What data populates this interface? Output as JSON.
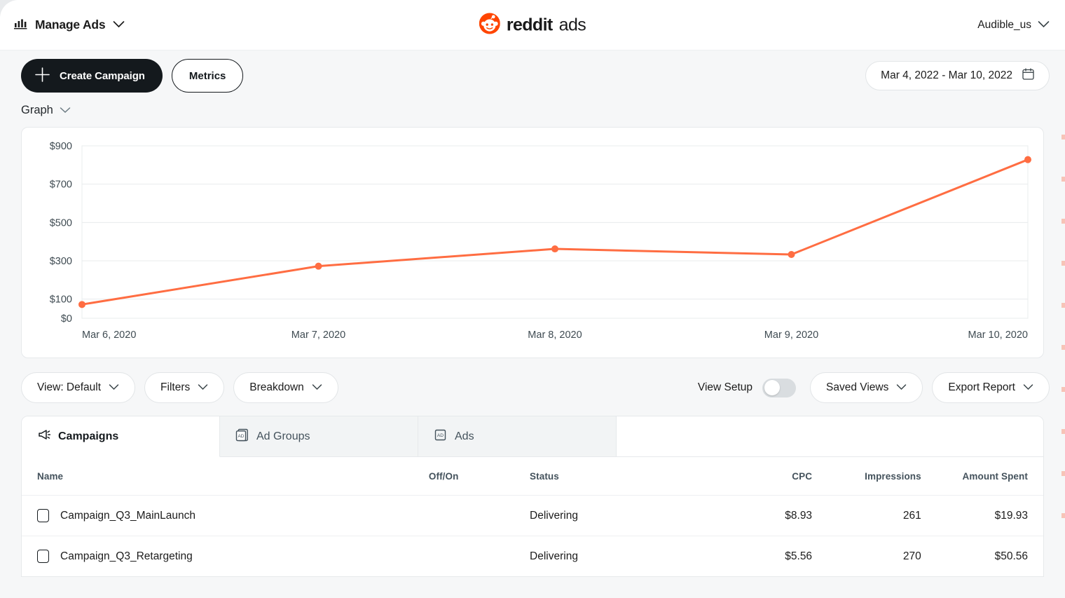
{
  "topbar": {
    "menu_label": "Manage Ads",
    "menu_icon": "bar-chart-icon",
    "brand_word": "reddit",
    "brand_ads": "ads",
    "brand_icon": "reddit-snoo-icon",
    "account_label": "Audible_us",
    "chevron_icon": "chevron-down-icon"
  },
  "actions": {
    "create_campaign_label": "Create Campaign",
    "create_icon": "plus-icon",
    "metrics_label": "Metrics",
    "date_range_label": "Mar 4, 2022 - Mar 10, 2022",
    "calendar_icon": "calendar-icon"
  },
  "graph_section": {
    "label": "Graph"
  },
  "chart_data": {
    "type": "line",
    "title": "",
    "xlabel": "",
    "ylabel": "",
    "categories": [
      "Mar 6, 2020",
      "Mar 7, 2020",
      "Mar 8, 2020",
      "Mar 9, 2020",
      "Mar 10, 2020"
    ],
    "series": [
      {
        "name": "Amount Spent",
        "values": [
          72,
          272,
          362,
          333,
          828
        ],
        "color": "#ff6d42"
      }
    ],
    "ytick_labels": [
      "$0",
      "$100",
      "$300",
      "$500",
      "$700",
      "$900"
    ],
    "ytick_values": [
      0,
      100,
      300,
      500,
      700,
      900
    ],
    "ylim": [
      0,
      900
    ],
    "grid": true,
    "legend": "none",
    "point_radius": 5,
    "line_width": 3
  },
  "controls": {
    "view_label": "View: Default",
    "filters_label": "Filters",
    "breakdown_label": "Breakdown",
    "view_setup_label": "View Setup",
    "view_setup_on": false,
    "saved_views_label": "Saved Views",
    "export_report_label": "Export Report"
  },
  "tabs": [
    {
      "label": "Campaigns",
      "icon": "megaphone-icon",
      "active": true
    },
    {
      "label": "Ad Groups",
      "icon": "ad-box-icon",
      "active": false
    },
    {
      "label": "Ads",
      "icon": "ad-box-icon",
      "active": false
    }
  ],
  "table": {
    "headers": {
      "name": "Name",
      "offon": "Off/On",
      "status": "Status",
      "cpc": "CPC",
      "impressions": "Impressions",
      "amount_spent": "Amount Spent"
    },
    "rows": [
      {
        "name": "Campaign_Q3_MainLaunch",
        "enabled": true,
        "status": "Delivering",
        "cpc": "$8.93",
        "impressions": "261",
        "amount_spent": "$19.93"
      },
      {
        "name": "Campaign_Q3_Retargeting",
        "enabled": true,
        "status": "Delivering",
        "cpc": "$5.56",
        "impressions": "270",
        "amount_spent": "$50.56"
      }
    ]
  },
  "colors": {
    "accent": "#ff6d42",
    "brand_orange": "#ff4500",
    "dark": "#14191d",
    "toggle_on": "#46c05a",
    "page_bg": "#f6f7f8"
  }
}
